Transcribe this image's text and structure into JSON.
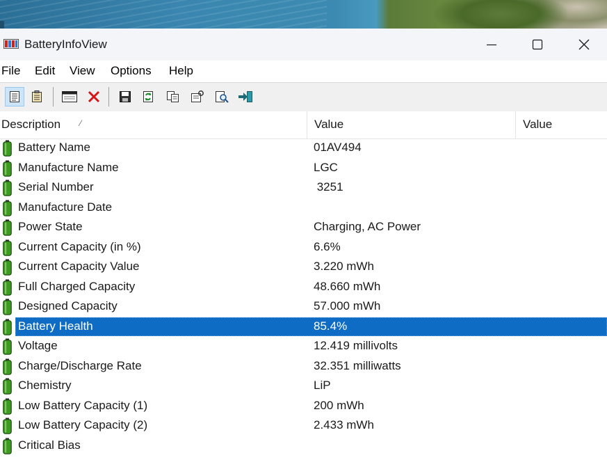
{
  "window": {
    "title": "BatteryInfoView",
    "controls": [
      "minimize",
      "maximize",
      "close"
    ]
  },
  "menu": [
    "File",
    "Edit",
    "View",
    "Options",
    "Help"
  ],
  "toolbar": {
    "icons": [
      "general-view-icon",
      "clipboard-view-icon",
      "window-icon",
      "delete-icon",
      "save-icon",
      "refresh-icon",
      "copy-icon",
      "properties-icon",
      "find-icon",
      "exit-icon"
    ]
  },
  "columns": {
    "description": "Description",
    "value": "Value",
    "value2": "Value"
  },
  "rows": [
    {
      "description": "Battery Name",
      "value": "01AV494"
    },
    {
      "description": "Manufacture Name",
      "value": "LGC"
    },
    {
      "description": "Serial Number",
      "value": " 3251"
    },
    {
      "description": "Manufacture Date",
      "value": ""
    },
    {
      "description": "Power State",
      "value": "Charging, AC Power"
    },
    {
      "description": "Current Capacity (in %)",
      "value": "6.6%"
    },
    {
      "description": "Current Capacity Value",
      "value": "3.220 mWh"
    },
    {
      "description": "Full Charged Capacity",
      "value": "48.660 mWh"
    },
    {
      "description": "Designed Capacity",
      "value": "57.000 mWh"
    },
    {
      "description": "Battery Health",
      "value": "85.4%",
      "selected": true
    },
    {
      "description": "Voltage",
      "value": "12.419 millivolts"
    },
    {
      "description": "Charge/Discharge Rate",
      "value": "32.351 milliwatts"
    },
    {
      "description": "Chemistry",
      "value": "LiP"
    },
    {
      "description": "Low Battery Capacity (1)",
      "value": "200 mWh"
    },
    {
      "description": "Low Battery Capacity (2)",
      "value": "2.433 mWh"
    },
    {
      "description": "Critical Bias",
      "value": ""
    }
  ],
  "colors": {
    "selection": "#0f6cc5",
    "battery_green": "#3e9a23"
  }
}
